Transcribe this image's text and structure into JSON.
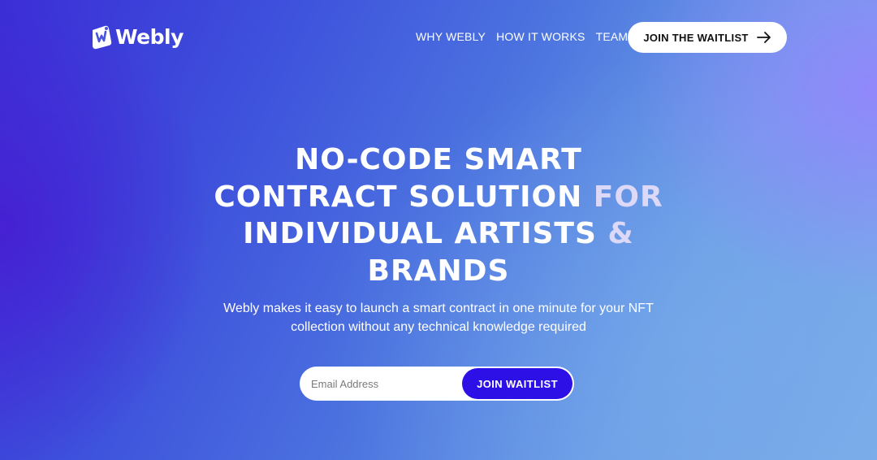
{
  "brand": {
    "name": "Webly",
    "logo_icon": "webly-logo-icon"
  },
  "nav": {
    "links": [
      {
        "label": "WHY WEBLY"
      },
      {
        "label": "HOW IT WORKS"
      },
      {
        "label": "TEAM"
      }
    ],
    "cta_label": "JOIN THE WAITLIST",
    "cta_icon": "arrow-right-icon"
  },
  "hero": {
    "title_lines": [
      {
        "main": "NO-CODE SMART",
        "accent": ""
      },
      {
        "main": "CONTRACT SOLUTION ",
        "accent": "FOR"
      },
      {
        "main": "INDIVIDUAL ARTISTS ",
        "accent": "&"
      },
      {
        "main": "BRANDS",
        "accent": ""
      }
    ],
    "subtitle_line1": "Webly makes it easy to launch a smart contract in one minute for your NFT",
    "subtitle_line2": "collection without any technical knowledge required"
  },
  "waitlist": {
    "email_placeholder": "Email Address",
    "email_value": "",
    "button_label": "JOIN WAITLIST"
  },
  "colors": {
    "accent_button": "#2c10e6",
    "title_accent": "#dcd8f7",
    "gradient_start": "#3b2fd6",
    "gradient_end": "#7daee9"
  }
}
